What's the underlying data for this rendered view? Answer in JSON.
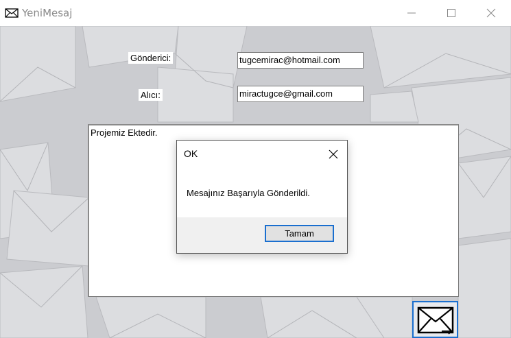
{
  "window": {
    "title": "YeniMesaj",
    "icon": "envelope-icon"
  },
  "form": {
    "sender_label": "Gönderici:",
    "sender_value": "tugcemirac@hotmail.com",
    "recipient_label": "Alıcı:",
    "recipient_value": "miractugce@gmail.com",
    "message_body": "Projemiz Ektedir.",
    "send_icon": "envelope-send-icon"
  },
  "dialog": {
    "title": "OK",
    "message": "Mesajınız Başarıyla Gönderildi.",
    "ok_label": "Tamam"
  },
  "colors": {
    "accent": "#1a6fcf",
    "background": "#cfd0d3"
  }
}
